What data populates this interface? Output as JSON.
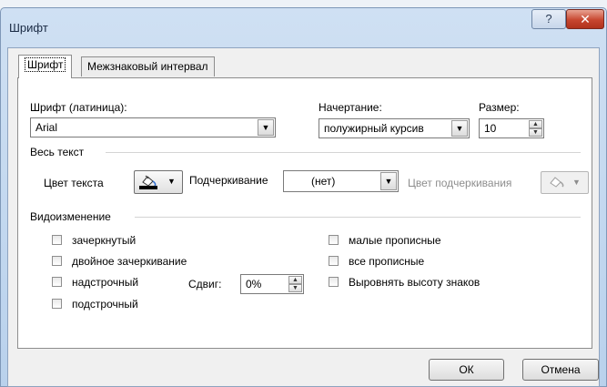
{
  "window": {
    "title": "Шрифт",
    "help_label": "?",
    "close_label": "✕"
  },
  "tabs": [
    {
      "label": "Шрифт",
      "selected": true
    },
    {
      "label": "Межзнаковый интервал",
      "selected": false
    }
  ],
  "font": {
    "label": "Шрифт (латиница):",
    "value": "Arial"
  },
  "style": {
    "label": "Начертание:",
    "value": "полужирный курсив"
  },
  "size": {
    "label": "Размер:",
    "value": "10"
  },
  "all_text": {
    "section_label": "Весь текст",
    "font_color_label": "Цвет текста",
    "underline_label": "Подчеркивание",
    "underline_value": "(нет)",
    "underline_color_label": "Цвет подчеркивания",
    "font_color_hex": "#000000"
  },
  "effects": {
    "section_label": "Видоизменение",
    "strikethrough": {
      "label": "зачеркнутый",
      "checked": false
    },
    "double_strikethrough": {
      "label": "двойное зачеркивание",
      "checked": false
    },
    "superscript": {
      "label": "надстрочный",
      "checked": false
    },
    "subscript": {
      "label": "подстрочный",
      "checked": false
    },
    "offset_label": "Сдвиг:",
    "offset_value": "0%",
    "small_caps": {
      "label": "малые прописные",
      "checked": false
    },
    "all_caps": {
      "label": "все прописные",
      "checked": false
    },
    "equalize_height": {
      "label": "Выровнять высоту знаков",
      "checked": false
    }
  },
  "buttons": {
    "ok": "ОК",
    "cancel": "Отмена"
  },
  "icons": {
    "help": "help-icon",
    "close": "close-icon",
    "dropdown": "dropdown-arrow-icon",
    "paint_bucket": "paint-bucket-icon",
    "spin": "spin-arrows-icon"
  }
}
